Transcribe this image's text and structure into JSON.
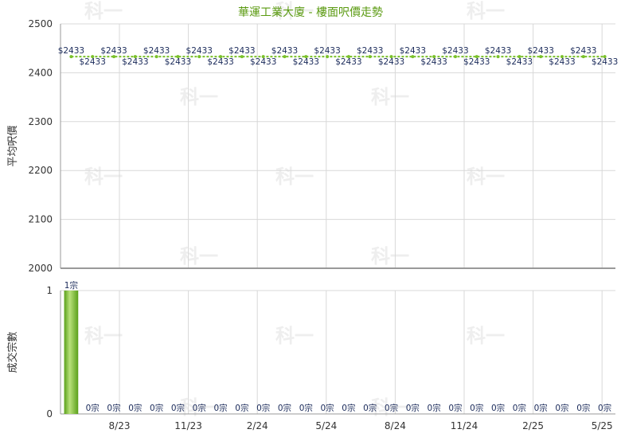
{
  "title": "華運工業大廈 - 樓面呎價走勢",
  "watermark_text": "科一",
  "colors": {
    "title": "#5a9a10",
    "price_line": "#7ac12a",
    "price_label": "#1a2a5a",
    "bar_light": "#b8e07a",
    "bar_dark": "#5aa01a",
    "grid": "#d8d8d8",
    "axis": "#999999",
    "watermark": "#eeeeee"
  },
  "chart_data": [
    {
      "type": "line",
      "ylabel": "平均呎價",
      "ylim": [
        2000,
        2500
      ],
      "y_ticks": [
        "2000",
        "2100",
        "2200",
        "2300",
        "2400",
        "2500"
      ],
      "x_ticks": [
        "8/23",
        "11/23",
        "2/24",
        "5/24",
        "8/24",
        "11/24",
        "2/25",
        "5/25"
      ],
      "series": [
        {
          "values": [
            2433,
            2433,
            2433,
            2433,
            2433,
            2433,
            2433,
            2433,
            2433,
            2433,
            2433,
            2433,
            2433,
            2433,
            2433,
            2433,
            2433,
            2433,
            2433,
            2433,
            2433,
            2433,
            2433,
            2433,
            2433,
            2433
          ],
          "labels": [
            "$2433",
            "$2433",
            "$2433",
            "$2433",
            "$2433",
            "$2433",
            "$2433",
            "$2433",
            "$2433",
            "$2433",
            "$2433",
            "$2433",
            "$2433",
            "$2433",
            "$2433",
            "$2433",
            "$2433",
            "$2433",
            "$2433",
            "$2433",
            "$2433",
            "$2433",
            "$2433",
            "$2433",
            "$2433",
            "$2433"
          ]
        }
      ]
    },
    {
      "type": "bar",
      "ylabel": "成交宗數",
      "ylim": [
        0,
        1
      ],
      "y_ticks": [
        "0",
        "1"
      ],
      "x_ticks": [
        "8/23",
        "11/23",
        "2/24",
        "5/24",
        "8/24",
        "11/24",
        "2/25",
        "5/25"
      ],
      "values": [
        1,
        0,
        0,
        0,
        0,
        0,
        0,
        0,
        0,
        0,
        0,
        0,
        0,
        0,
        0,
        0,
        0,
        0,
        0,
        0,
        0,
        0,
        0,
        0,
        0,
        0
      ],
      "labels": [
        "1宗",
        "0宗",
        "0宗",
        "0宗",
        "0宗",
        "0宗",
        "0宗",
        "0宗",
        "0宗",
        "0宗",
        "0宗",
        "0宗",
        "0宗",
        "0宗",
        "0宗",
        "0宗",
        "0宗",
        "0宗",
        "0宗",
        "0宗",
        "0宗",
        "0宗",
        "0宗",
        "0宗",
        "0宗",
        "0宗"
      ]
    }
  ]
}
